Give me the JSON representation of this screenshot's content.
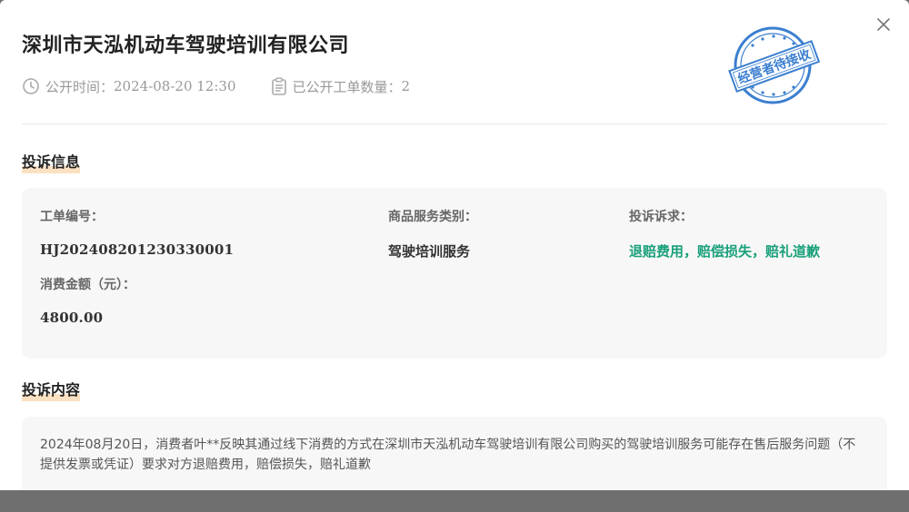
{
  "header": {
    "company_name": "深圳市天泓机动车驾驶培训有限公司",
    "publish_time_label": "公开时间：",
    "publish_time_value": "2024-08-20 12:30",
    "order_count_label": "已公开工单数量：",
    "order_count_value": "2",
    "stamp_text": "经营者待接收"
  },
  "complaint_info": {
    "section_title": "投诉信息",
    "order_no_label": "工单编号：",
    "order_no_value": "HJ2024082012303300​01",
    "category_label": "商品服务类别：",
    "category_value": "驾驶培训服务",
    "demand_label": "投诉诉求：",
    "demand_value": "退赔费用，赔偿损失，赔礼道歉",
    "amount_label": "消费金额（元）：",
    "amount_value": "4800.00"
  },
  "complaint_content": {
    "section_title": "投诉内容",
    "text": "2024年08月20日，消费者叶**反映其通过线下消费的方式在深圳市天泓机动车驾驶培训有限公司购买的驾驶培训服务可能存在售后服务问题（不提供发票或凭证）要求对方退赔费用，赔偿损失，赔礼道歉"
  },
  "colors": {
    "accent_green": "#19a07a",
    "stamp_blue": "#3b7fd0",
    "highlight": "#fbe1c2"
  },
  "icons": {
    "close": "close-icon",
    "clock": "clock-icon",
    "clipboard": "clipboard-icon"
  }
}
